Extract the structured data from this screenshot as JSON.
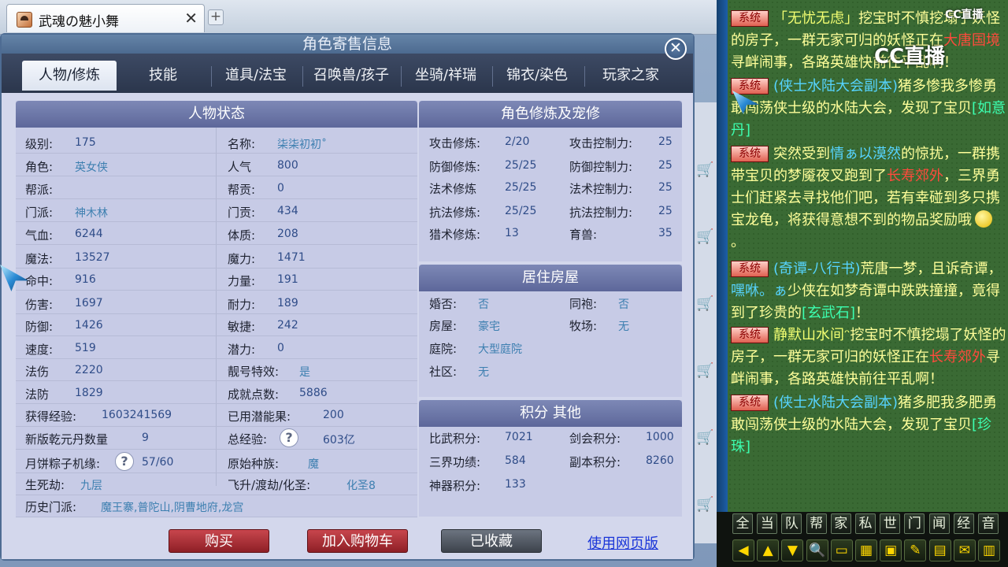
{
  "browser": {
    "tab_title": "武魂の魅小舞",
    "close_glyph": "✕",
    "newtab_glyph": "+"
  },
  "dialog": {
    "title": "角色寄售信息",
    "close_glyph": "✕",
    "tabs": [
      "人物/修炼",
      "技能",
      "道具/法宝",
      "召唤兽/孩子",
      "坐骑/祥瑞",
      "锦衣/染色",
      "玩家之家"
    ],
    "active_tab": "人物/修炼"
  },
  "status": {
    "header": "人物状态",
    "left": [
      {
        "label": "级别:",
        "value": "175"
      },
      {
        "label": "角色:",
        "value": "英女侠"
      },
      {
        "label": "帮派:",
        "value": ""
      },
      {
        "label": "门派:",
        "value": "神木林"
      },
      {
        "label": "气血:",
        "value": "6244"
      },
      {
        "label": "魔法:",
        "value": "13527"
      },
      {
        "label": "命中:",
        "value": "916"
      },
      {
        "label": "伤害:",
        "value": "1697"
      },
      {
        "label": "防御:",
        "value": "1426"
      },
      {
        "label": "速度:",
        "value": "519"
      },
      {
        "label": "法伤",
        "value": "2220"
      },
      {
        "label": "法防",
        "value": "1829"
      }
    ],
    "right": [
      {
        "label": "名称:",
        "value": "柒柒初初˚"
      },
      {
        "label": "人气",
        "value": "800"
      },
      {
        "label": "帮贡:",
        "value": "0"
      },
      {
        "label": "门贡:",
        "value": "434"
      },
      {
        "label": "体质:",
        "value": "208"
      },
      {
        "label": "魔力:",
        "value": "1471"
      },
      {
        "label": "力量:",
        "value": "191"
      },
      {
        "label": "耐力:",
        "value": "189"
      },
      {
        "label": "敏捷:",
        "value": "242"
      },
      {
        "label": "潜力:",
        "value": "0"
      },
      {
        "label": "靓号特效:",
        "value": "是"
      },
      {
        "label": "成就点数:",
        "value": "5886"
      }
    ],
    "wide": {
      "exp_label": "获得经验:",
      "exp_value": "1603241569",
      "potential_label": "已用潜能果:",
      "potential_value": "200",
      "yuandan_label": "新版乾元丹数量",
      "yuandan_value": "9",
      "total_exp_label": "总经验:",
      "total_exp_value": "603亿",
      "zongzi_label": "月饼粽子机缘:",
      "zongzi_value": "57/60",
      "race_label": "原始种族:",
      "race_value": "魔",
      "life_label": "生死劫:",
      "life_value": "九层",
      "fly_label": "飞升/渡劫/化圣:",
      "fly_value": "化圣8",
      "history_label": "历史门派:",
      "history_value": "魔王寨,普陀山,阴曹地府,龙宫",
      "help_glyph": "?"
    }
  },
  "cultivation": {
    "header": "角色修炼及宠修",
    "rows": [
      {
        "label": "攻击修炼:",
        "value": "2/20",
        "label2": "攻击控制力:",
        "value2": "25"
      },
      {
        "label": "防御修炼:",
        "value": "25/25",
        "label2": "防御控制力:",
        "value2": "25"
      },
      {
        "label": "法术修炼",
        "value": "25/25",
        "label2": "法术控制力:",
        "value2": "25"
      },
      {
        "label": "抗法修炼:",
        "value": "25/25",
        "label2": "抗法控制力:",
        "value2": "25"
      },
      {
        "label": "猎术修炼:",
        "value": "13",
        "label2": "育兽:",
        "value2": "35"
      }
    ]
  },
  "house": {
    "header": "居住房屋",
    "rows": [
      {
        "label": "婚否:",
        "value": "否",
        "label2": "同袍:",
        "value2": "否"
      },
      {
        "label": "房屋:",
        "value": "豪宅",
        "label2": "牧场:",
        "value2": "无"
      },
      {
        "label": "庭院:",
        "value": "大型庭院"
      },
      {
        "label": "社区:",
        "value": "无"
      }
    ]
  },
  "points": {
    "header": "积分 其他",
    "rows": [
      {
        "label": "比武积分:",
        "value": "7021",
        "label2": "剑会积分:",
        "value2": "1000"
      },
      {
        "label": "三界功绩:",
        "value": "584",
        "label2": "副本积分:",
        "value2": "8260"
      },
      {
        "label": "神器积分:",
        "value": "133"
      }
    ]
  },
  "actions": {
    "buy": "购买",
    "add_cart": "加入购物车",
    "collected": "已收藏",
    "web_link": "使用网页版"
  },
  "overlay": {
    "logo": "CC直播",
    "logo_small": "CC直播"
  },
  "chat": {
    "badge": "系统",
    "messages": [
      {
        "parts": [
          {
            "t": "「无忧无虑」",
            "c": "c1"
          },
          {
            "t": "挖宝时不慎挖塌了妖怪的房子，一群无家可归的妖怪正在",
            "c": ""
          },
          {
            "t": "大唐国境",
            "c": "c3"
          },
          {
            "t": "寻衅闹事，各路英雄快前往平乱啊！",
            "c": ""
          }
        ]
      },
      {
        "parts": [
          {
            "t": "(侠士水陆大会副本)",
            "c": "c2"
          },
          {
            "t": "猪多惨我多惨勇敢闯荡侠士级的水陆大会，发现了宝贝",
            "c": ""
          },
          {
            "t": "[如意丹]",
            "c": "c4"
          }
        ]
      },
      {
        "parts": [
          {
            "t": "突然受到",
            "c": ""
          },
          {
            "t": "情ぁ以漠然",
            "c": "c2"
          },
          {
            "t": "的惊扰，一群携带宝贝的梦魇夜叉跑到了",
            "c": ""
          },
          {
            "t": "长寿郊外",
            "c": "c3"
          },
          {
            "t": "，三界勇士们赶紧去寻找他们吧，若有幸碰到多只携宝龙龟，将获得意想不到的物品奖励哦",
            "c": ""
          },
          {
            "t": "。",
            "c": ""
          }
        ]
      },
      {
        "parts": [
          {
            "t": "(奇谭-八行书)",
            "c": "c2"
          },
          {
            "t": "荒唐一梦，且诉奇谭，",
            "c": ""
          },
          {
            "t": "嘿咻。ぁ",
            "c": "c2"
          },
          {
            "t": "少侠在如梦奇谭中跌跌撞撞，竟得到了珍贵的",
            "c": ""
          },
          {
            "t": "[玄武石]",
            "c": "c4"
          },
          {
            "t": "！",
            "c": ""
          }
        ]
      },
      {
        "parts": [
          {
            "t": "静默山水间ᵔ",
            "c": "c1"
          },
          {
            "t": "挖宝时不慎挖塌了妖怪的房子，一群无家可归的妖怪正在",
            "c": ""
          },
          {
            "t": "长寿郊外",
            "c": "c3"
          },
          {
            "t": "寻衅闹事，各路英雄快前往平乱啊！",
            "c": ""
          }
        ]
      },
      {
        "parts": [
          {
            "t": "(侠士水陆大会副本)",
            "c": "c2"
          },
          {
            "t": "猪多肥我多肥勇敢闯荡侠士级的水陆大会，发现了宝贝",
            "c": ""
          },
          {
            "t": "[珍珠]",
            "c": "c4"
          }
        ]
      }
    ],
    "channel_buttons": [
      "全",
      "当",
      "队",
      "帮",
      "家",
      "私",
      "世",
      "门",
      "闻",
      "经",
      "音"
    ],
    "tool_buttons": [
      "◀",
      "▲",
      "▼",
      "🔍",
      "▭",
      "▦",
      "▣",
      "✎",
      "▤",
      "✉",
      "▥"
    ]
  }
}
